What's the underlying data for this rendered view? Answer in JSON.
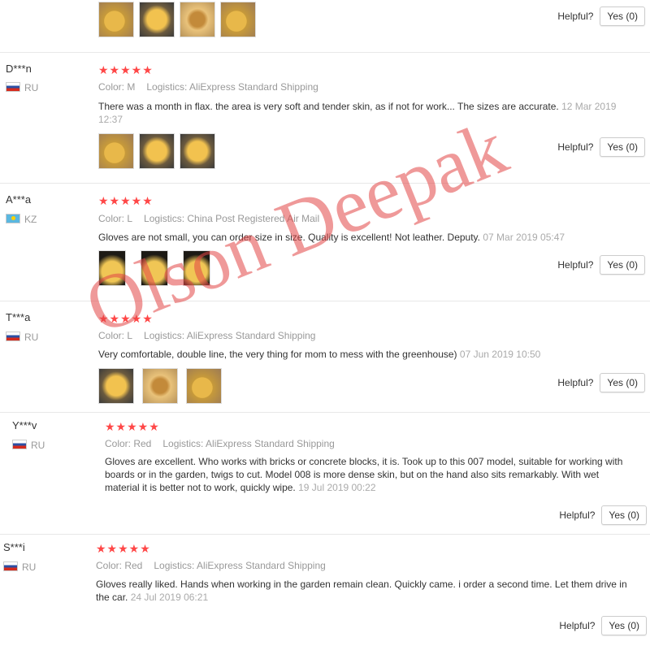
{
  "helpful_label": "Helpful?",
  "yes_label": "Yes (0)",
  "stars": "★★★★★",
  "watermark": "Olson Deepak",
  "colors": {
    "star": "#ff4747",
    "watermark": "#e24646"
  },
  "reviews": [
    {
      "color": "",
      "logistics": "",
      "text": "",
      "date": "",
      "photos": [
        "glove1",
        "glove2",
        "glove4",
        "glove1"
      ]
    },
    {
      "user": "D***n",
      "country": "RU",
      "flag": "ru",
      "color": "Color: M",
      "logistics": "Logistics: AliExpress Standard Shipping",
      "text": "There was a month in flax. the area is very soft and tender skin, as if not for work... The sizes are accurate.",
      "date": "12 Mar 2019 12:37",
      "photos": [
        "glove1",
        "glove2",
        "glove2"
      ]
    },
    {
      "user": "A***a",
      "country": "KZ",
      "flag": "kz",
      "color": "Color: L",
      "logistics": "Logistics: China Post Registered Air Mail",
      "text": "Gloves are not small, you can order size in size. Quality is excellent! Not leather. Deputy.",
      "date": "07 Mar 2019 05:47",
      "photos": [
        "glove3",
        "glove3",
        "glove3"
      ]
    },
    {
      "user": "T***a",
      "country": "RU",
      "flag": "ru",
      "color": "Color: L",
      "logistics": "Logistics: AliExpress Standard Shipping",
      "text": "Very comfortable, double line, the very thing for mom to mess with the greenhouse)",
      "date": "07 Jun 2019 10:50",
      "photos": [
        "glove2",
        "glove4",
        "glove1"
      ]
    },
    {
      "user": "Y***v",
      "country": "RU",
      "flag": "ru",
      "color": "Color: Red",
      "logistics": "Logistics: AliExpress Standard Shipping",
      "text": "Gloves are excellent. Who works with bricks or concrete blocks, it is. Took up to this 007 model, suitable for working with boards or in the garden, twigs to cut. Model 008 is more dense skin, but on the hand also sits remarkably. With wet material it is better not to work, quickly wipe.",
      "date": "19 Jul 2019 00:22"
    },
    {
      "user": "S***i",
      "country": "RU",
      "flag": "ru",
      "color": "Color: Red",
      "logistics": "Logistics: AliExpress Standard Shipping",
      "text": "Gloves really liked. Hands when working in the garden remain clean. Quickly came. i order a second time. Let them drive in the car.",
      "date": "24 Jul 2019 06:21"
    }
  ]
}
